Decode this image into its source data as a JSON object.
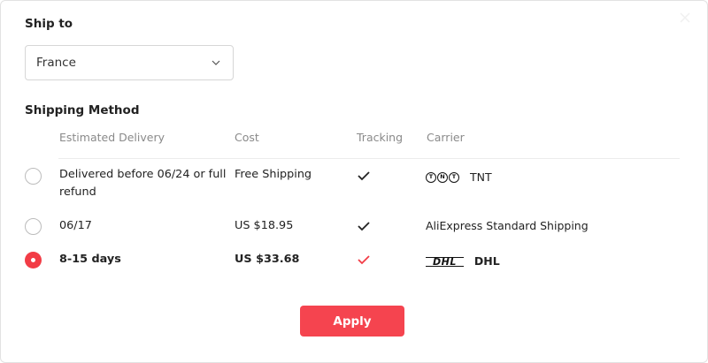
{
  "ship_to": {
    "title": "Ship to",
    "selected_country": "France",
    "chevron_icon": "chevron-down-icon"
  },
  "shipping_method": {
    "title": "Shipping Method",
    "columns": [
      "Estimated Delivery",
      "Cost",
      "Tracking",
      "Carrier"
    ],
    "options": [
      {
        "delivery": "Delivered before 06/24 or full refund",
        "cost": "Free Shipping",
        "tracking": true,
        "carrier": "TNT",
        "carrier_logo": "TNT",
        "selected": false
      },
      {
        "delivery": "06/17",
        "cost": "US $18.95",
        "tracking": true,
        "carrier": "AliExpress Standard Shipping",
        "carrier_logo": "",
        "selected": false
      },
      {
        "delivery": "8-15 days",
        "cost": "US $33.68",
        "tracking": true,
        "carrier": "DHL",
        "carrier_logo": "DHL",
        "selected": true
      }
    ]
  },
  "apply_label": "Apply",
  "colors": {
    "accent": "#f5444f",
    "check_selected": "#f23c46",
    "check_default": "#222222"
  }
}
